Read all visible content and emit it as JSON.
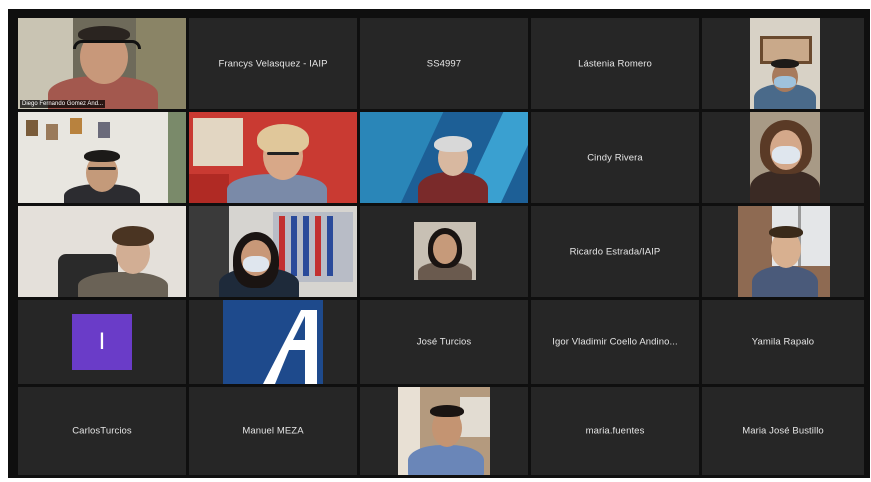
{
  "meeting": {
    "tiles": [
      {
        "type": "video",
        "label": "Diego Fernando Gomez And..."
      },
      {
        "type": "name",
        "name": "Francys Velasquez - IAIP"
      },
      {
        "type": "name",
        "name": "SS4997"
      },
      {
        "type": "name",
        "name": "Lástenia Romero"
      },
      {
        "type": "video",
        "label": ""
      },
      {
        "type": "video",
        "label": ""
      },
      {
        "type": "video",
        "label": ""
      },
      {
        "type": "video",
        "label": ""
      },
      {
        "type": "name",
        "name": "Cindy Rivera"
      },
      {
        "type": "video",
        "label": ""
      },
      {
        "type": "video",
        "label": ""
      },
      {
        "type": "video",
        "label": ""
      },
      {
        "type": "video",
        "label": ""
      },
      {
        "type": "name",
        "name": "Ricardo Estrada/IAIP"
      },
      {
        "type": "video",
        "label": ""
      },
      {
        "type": "avatar",
        "initial": "I"
      },
      {
        "type": "logo",
        "label": ""
      },
      {
        "type": "name",
        "name": "José Turcios"
      },
      {
        "type": "name",
        "name": "Igor Vladimir Coello Andino..."
      },
      {
        "type": "name",
        "name": "Yamila Rapalo"
      },
      {
        "type": "name",
        "name": "CarlosTurcios"
      },
      {
        "type": "name",
        "name": "Manuel MEZA"
      },
      {
        "type": "video",
        "label": ""
      },
      {
        "type": "name",
        "name": "maria.fuentes"
      },
      {
        "type": "name",
        "name": "Maria José Bustillo"
      }
    ],
    "active_speaker_index": 0
  },
  "colors": {
    "tile_bg": "#262626",
    "frame_bg": "#0f0f0f",
    "active_border": "#e8d44d",
    "avatar_bg": "#6a3cc8"
  }
}
